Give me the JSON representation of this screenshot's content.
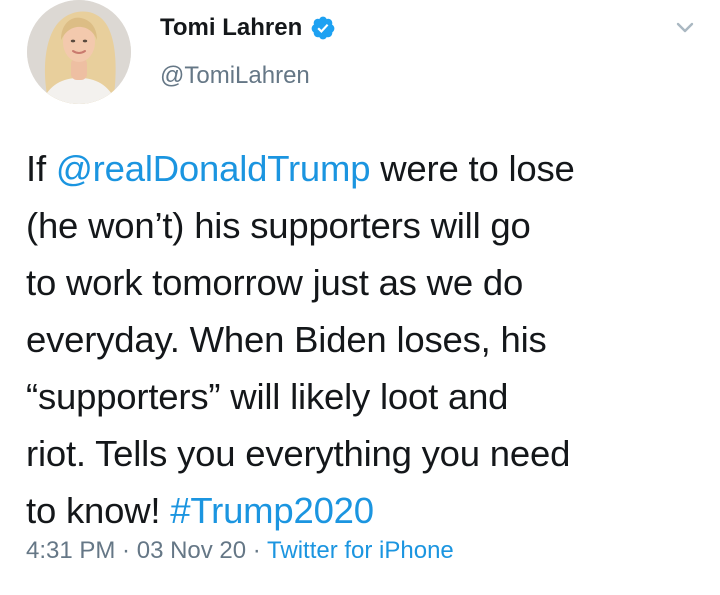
{
  "author": {
    "display_name": "Tomi Lahren",
    "handle": "@TomiLahren",
    "verified": true
  },
  "tweet": {
    "lines": [
      [
        {
          "text": "If ",
          "link": false
        },
        {
          "text": "@realDonaldTrump",
          "link": true
        },
        {
          "text": " were to lose",
          "link": false
        }
      ],
      [
        {
          "text": "(he won’t) his supporters will go",
          "link": false
        }
      ],
      [
        {
          "text": "to work tomorrow just as we do",
          "link": false
        }
      ],
      [
        {
          "text": "everyday. When Biden loses, his",
          "link": false
        }
      ],
      [
        {
          "text": "“supporters” will likely loot and",
          "link": false
        }
      ],
      [
        {
          "text": "riot. Tells you everything you need",
          "link": false
        }
      ],
      [
        {
          "text": "to know! ",
          "link": false
        },
        {
          "text": "#Trump2020",
          "link": true
        }
      ]
    ]
  },
  "meta": {
    "time": "4:31 PM",
    "separator": " · ",
    "date": "03 Nov 20",
    "source": "Twitter for iPhone"
  },
  "icons": {
    "verified": "verified-badge-icon",
    "menu": "chevron-down-icon"
  },
  "colors": {
    "link": "#1b95e0",
    "secondary_text": "#657786",
    "primary_text": "#14171a",
    "verified_badge": "#1da1f2"
  }
}
